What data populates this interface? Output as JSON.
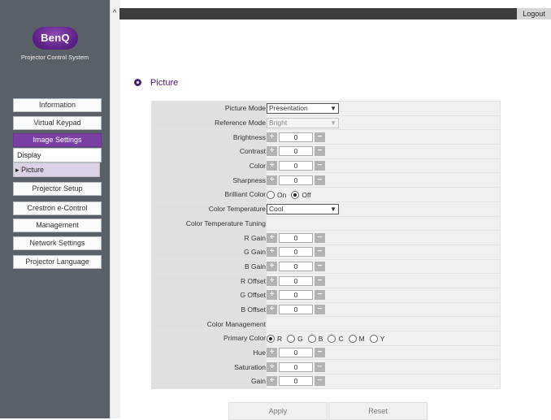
{
  "brand": {
    "logo_text": "BenQ",
    "subtitle": "Projector Control System"
  },
  "topbar": {
    "logout_label": "Logout"
  },
  "sidebar": {
    "items": [
      {
        "label": "Information"
      },
      {
        "label": "Virtual Keypad"
      },
      {
        "label": "Image Settings"
      },
      {
        "label": "Projector Setup"
      },
      {
        "label": "Crestron e-Control"
      },
      {
        "label": "Management"
      },
      {
        "label": "Network Settings"
      },
      {
        "label": "Projector Language"
      }
    ],
    "subitems": [
      {
        "label": "Display"
      },
      {
        "label": "Picture"
      }
    ]
  },
  "section": {
    "title": "Picture"
  },
  "form": {
    "picture_mode": {
      "label": "Picture Mode",
      "value": "Presentation"
    },
    "reference_mode": {
      "label": "Reference Mode",
      "value": "Bright"
    },
    "brightness": {
      "label": "Brightness",
      "value": "0"
    },
    "contrast": {
      "label": "Contrast",
      "value": "0"
    },
    "color": {
      "label": "Color",
      "value": "0"
    },
    "sharpness": {
      "label": "Sharpness",
      "value": "0"
    },
    "brilliant_color": {
      "label": "Brilliant Color",
      "on_label": "On",
      "off_label": "Off",
      "selected": "Off"
    },
    "color_temperature": {
      "label": "Color Temperature",
      "value": "Cool"
    },
    "color_temperature_tuning": {
      "label": "Color Temperature Tuning"
    },
    "r_gain": {
      "label": "R Gain",
      "value": "0"
    },
    "g_gain": {
      "label": "G Gain",
      "value": "0"
    },
    "b_gain": {
      "label": "B Gain",
      "value": "0"
    },
    "r_offset": {
      "label": "R Offset",
      "value": "0"
    },
    "g_offset": {
      "label": "G Offset",
      "value": "0"
    },
    "b_offset": {
      "label": "B Offset",
      "value": "0"
    },
    "color_management": {
      "label": "Color Management"
    },
    "primary_color": {
      "label": "Primary Color",
      "options": [
        "R",
        "G",
        "B",
        "C",
        "M",
        "Y"
      ],
      "selected": "R"
    },
    "hue": {
      "label": "Hue",
      "value": "0"
    },
    "saturation": {
      "label": "Saturation",
      "value": "0"
    },
    "gain": {
      "label": "Gain",
      "value": "0"
    }
  },
  "actions": {
    "apply_label": "Apply",
    "reset_label": "Reset"
  },
  "icons": {
    "stepper_plus": "+",
    "stepper_minus": "−",
    "collapse": "chevron-up-icon",
    "dropdown": "chevron-down-icon"
  },
  "colors": {
    "accent": "#7a3fa3",
    "sidebar_bg": "#5a6068",
    "topbar_bg": "#3d3d3d",
    "title": "#4b1f73"
  }
}
